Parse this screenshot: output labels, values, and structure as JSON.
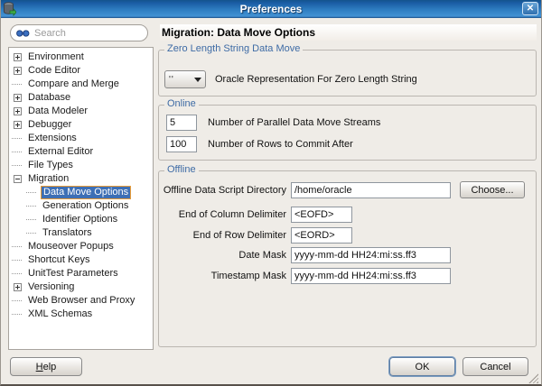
{
  "window": {
    "title": "Preferences",
    "icon": "database-export-icon",
    "close_icon": "close-x-icon"
  },
  "search": {
    "placeholder": "Search",
    "icon": "binoculars-icon"
  },
  "tree": {
    "items": [
      {
        "label": "Environment",
        "state": "collapsed",
        "level": 0
      },
      {
        "label": "Code Editor",
        "state": "collapsed",
        "level": 0
      },
      {
        "label": "Compare and Merge",
        "state": "leaf",
        "level": 0
      },
      {
        "label": "Database",
        "state": "collapsed",
        "level": 0
      },
      {
        "label": "Data Modeler",
        "state": "collapsed",
        "level": 0
      },
      {
        "label": "Debugger",
        "state": "collapsed",
        "level": 0
      },
      {
        "label": "Extensions",
        "state": "leaf",
        "level": 0
      },
      {
        "label": "External Editor",
        "state": "leaf",
        "level": 0
      },
      {
        "label": "File Types",
        "state": "leaf",
        "level": 0
      },
      {
        "label": "Migration",
        "state": "expanded",
        "level": 0
      },
      {
        "label": "Data Move Options",
        "state": "leaf",
        "level": 1,
        "selected": true
      },
      {
        "label": "Generation Options",
        "state": "leaf",
        "level": 1
      },
      {
        "label": "Identifier Options",
        "state": "leaf",
        "level": 1
      },
      {
        "label": "Translators",
        "state": "leaf",
        "level": 1
      },
      {
        "label": "Mouseover Popups",
        "state": "leaf",
        "level": 0
      },
      {
        "label": "Shortcut Keys",
        "state": "leaf",
        "level": 0
      },
      {
        "label": "UnitTest Parameters",
        "state": "leaf",
        "level": 0
      },
      {
        "label": "Versioning",
        "state": "collapsed",
        "level": 0
      },
      {
        "label": "Web Browser and Proxy",
        "state": "leaf",
        "level": 0
      },
      {
        "label": "XML Schemas",
        "state": "leaf",
        "level": 0
      }
    ]
  },
  "content": {
    "heading": "Migration: Data Move Options",
    "zero_length": {
      "title": "Zero Length String Data Move",
      "combo_value": "''",
      "combo_label": "Oracle Representation For Zero Length String",
      "dropdown_icon": "triangle-down-icon"
    },
    "online": {
      "title": "Online",
      "fields": [
        {
          "value": "5",
          "label": "Number of Parallel Data Move Streams"
        },
        {
          "value": "100",
          "label": "Number of Rows to Commit After"
        }
      ]
    },
    "offline": {
      "title": "Offline",
      "rows": [
        {
          "label": "Offline Data Script Directory",
          "value": "/home/oracle",
          "button": "Choose..."
        },
        {
          "label": "End of Column Delimiter",
          "value": "<EOFD>"
        },
        {
          "label": "End of Row Delimiter",
          "value": "<EORD>"
        },
        {
          "label": "Date Mask",
          "value": "yyyy-mm-dd HH24:mi:ss.ff3"
        },
        {
          "label": "Timestamp Mask",
          "value": "yyyy-mm-dd HH24:mi:ss.ff3"
        }
      ]
    }
  },
  "footer": {
    "help_label": "Help",
    "ok_label": "OK",
    "cancel_label": "Cancel"
  },
  "colors": {
    "window_bg": "#efece7",
    "titlebar_top": "#1a5ca3",
    "titlebar_bottom": "#4292d4",
    "selection_bg": "#3d6fb5",
    "selection_border": "#e79b38",
    "group_label": "#3e6ba5",
    "ok_focus_ring": "#7b9cc0",
    "icon_green": "#3fae49"
  }
}
